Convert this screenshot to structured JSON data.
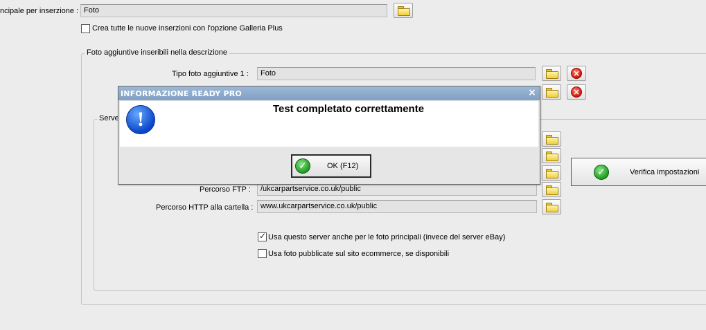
{
  "top": {
    "main_photo_label": "ncipale per inserzione :",
    "main_photo_value": "Foto",
    "galleria_plus_label": "Crea tutte le nuove inserzioni con l'opzione Galleria Plus",
    "galleria_plus_checked": false
  },
  "extra_photos": {
    "legend": "Foto aggiuntive inseribili nella descrizione",
    "tipo_label": "Tipo foto aggiuntive 1 :",
    "tipo_value": "Foto"
  },
  "server": {
    "legend": "Serve",
    "ftp_path_label": "Percorso FTP :",
    "ftp_path_value": "/ukcarpartservice.co.uk/public",
    "http_path_label": "Percorso HTTP alla cartella :",
    "http_path_value": "www.ukcarpartservice.co.uk/public",
    "use_server_label": "Usa questo server anche per le foto principali (invece del server eBay)",
    "use_server_checked": true,
    "use_ecommerce_label": "Usa foto pubblicate sul sito ecommerce, se disponibili",
    "use_ecommerce_checked": false,
    "verify_button": "Verifica impostazioni"
  },
  "dialog": {
    "title": "INFORMAZIONE READY PRO",
    "close": "×",
    "message": "Test completato correttamente",
    "ok_button": "OK (F12)"
  },
  "icons": {
    "folder": "folder-icon",
    "delete": "delete-icon",
    "info": "info-icon",
    "check": "green-check-icon"
  }
}
